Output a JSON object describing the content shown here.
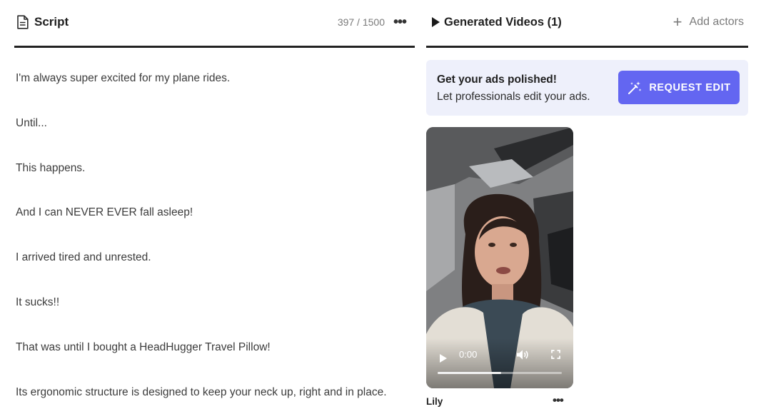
{
  "script_panel": {
    "title": "Script",
    "char_count": "397 / 1500",
    "more_label": "•••",
    "lines": [
      "I'm always super excited for my plane rides.",
      "Until...",
      "This happens.",
      "And I can NEVER EVER fall asleep!",
      "I arrived tired and unrested.",
      "It sucks!!",
      "That was until I bought a HeadHugger Travel Pillow!",
      "Its ergonomic structure is designed to keep your neck up, right and in place."
    ],
    "icon": "document-icon"
  },
  "videos_panel": {
    "title": "Generated Videos (1)",
    "add_actors_label": "Add actors",
    "plus_label": "+",
    "promo": {
      "title": "Get your ads polished!",
      "subtitle": "Let professionals edit your ads.",
      "button_label": "REQUEST EDIT",
      "button_color": "#6366f1",
      "background": "#eef0fb"
    },
    "video": {
      "time": "0:00",
      "progress": 0.51,
      "actor_name": "Lily",
      "more_label": "•••"
    }
  },
  "colors": {
    "accent": "#6366f1",
    "divider": "#222222",
    "muted_text": "#7a7a7a"
  }
}
